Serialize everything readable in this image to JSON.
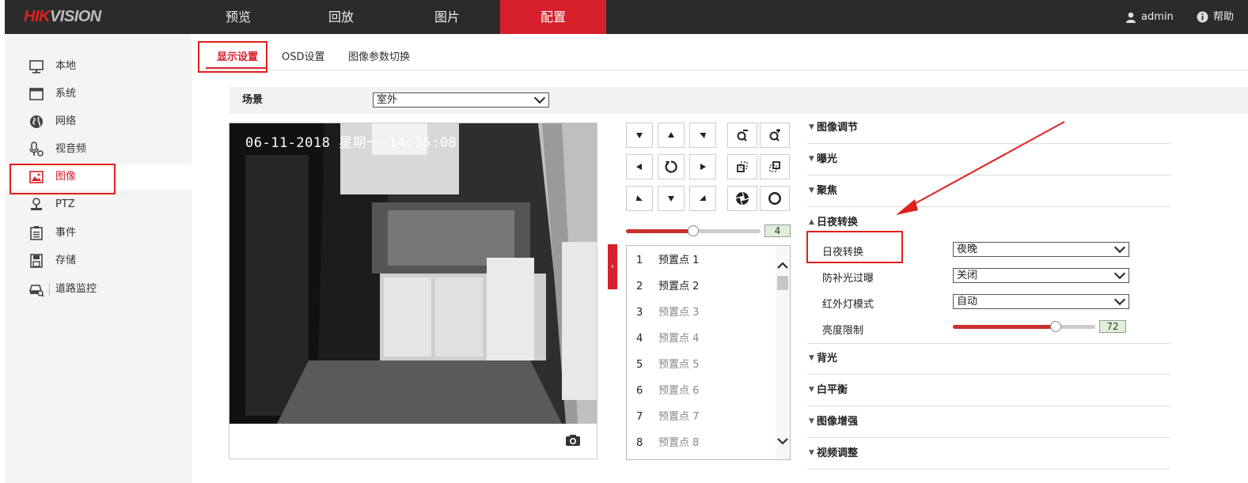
{
  "brand": {
    "logo_red": "HIK",
    "logo_grey": "VISION"
  },
  "topnav": [
    {
      "label": "预览"
    },
    {
      "label": "回放"
    },
    {
      "label": "图片"
    },
    {
      "label": "配置",
      "active": true
    }
  ],
  "user": {
    "name": "admin",
    "help": "帮助"
  },
  "sidebar": [
    {
      "label": "本地",
      "icon": "monitor-icon"
    },
    {
      "label": "系统",
      "icon": "window-icon"
    },
    {
      "label": "网络",
      "icon": "globe-icon"
    },
    {
      "label": "视音频",
      "icon": "microphone-icon"
    },
    {
      "label": "图像",
      "icon": "image-icon",
      "active": true
    },
    {
      "label": "PTZ",
      "icon": "ptz-camera-icon"
    },
    {
      "label": "事件",
      "icon": "clipboard-icon"
    },
    {
      "label": "存储",
      "icon": "floppy-disk-icon"
    },
    {
      "label": "道路监控",
      "icon": "vehicle-search-icon"
    }
  ],
  "tabs": [
    {
      "label": "显示设置",
      "active": true
    },
    {
      "label": "OSD设置"
    },
    {
      "label": "图像参数切换"
    }
  ],
  "scene": {
    "label": "场景",
    "value": "室外"
  },
  "video": {
    "osd_text": "06-11-2018 星期一 14:35:08"
  },
  "ptz": {
    "speed_value": "4",
    "speed_fraction": 0.5
  },
  "presets": [
    {
      "num": "1",
      "name": "预置点 1",
      "set": true
    },
    {
      "num": "2",
      "name": "预置点 2",
      "set": true
    },
    {
      "num": "3",
      "name": "预置点 3",
      "set": false
    },
    {
      "num": "4",
      "name": "预置点 4",
      "set": false
    },
    {
      "num": "5",
      "name": "预置点 5",
      "set": false
    },
    {
      "num": "6",
      "name": "预置点 6",
      "set": false
    },
    {
      "num": "7",
      "name": "预置点 7",
      "set": false
    },
    {
      "num": "8",
      "name": "预置点 8",
      "set": false
    }
  ],
  "sections": {
    "image_adjust": "图像调节",
    "exposure": "曝光",
    "focus": "聚焦",
    "day_night": "日夜转换",
    "backlight": "背光",
    "white_balance": "白平衡",
    "image_enhance": "图像增强",
    "video_adjust": "视频调整"
  },
  "day_night_fields": {
    "switch_label": "日夜转换",
    "switch_value": "夜晚",
    "overexposure_label": "防补光过曝",
    "overexposure_value": "关闭",
    "ir_label": "红外灯模式",
    "ir_value": "自动",
    "brightness_label": "亮度限制",
    "brightness_value": "72",
    "brightness_fraction": 0.72
  },
  "colors": {
    "accent": "#d7202b",
    "topbar": "#2b2b2b",
    "annotation": "#e0201d"
  }
}
